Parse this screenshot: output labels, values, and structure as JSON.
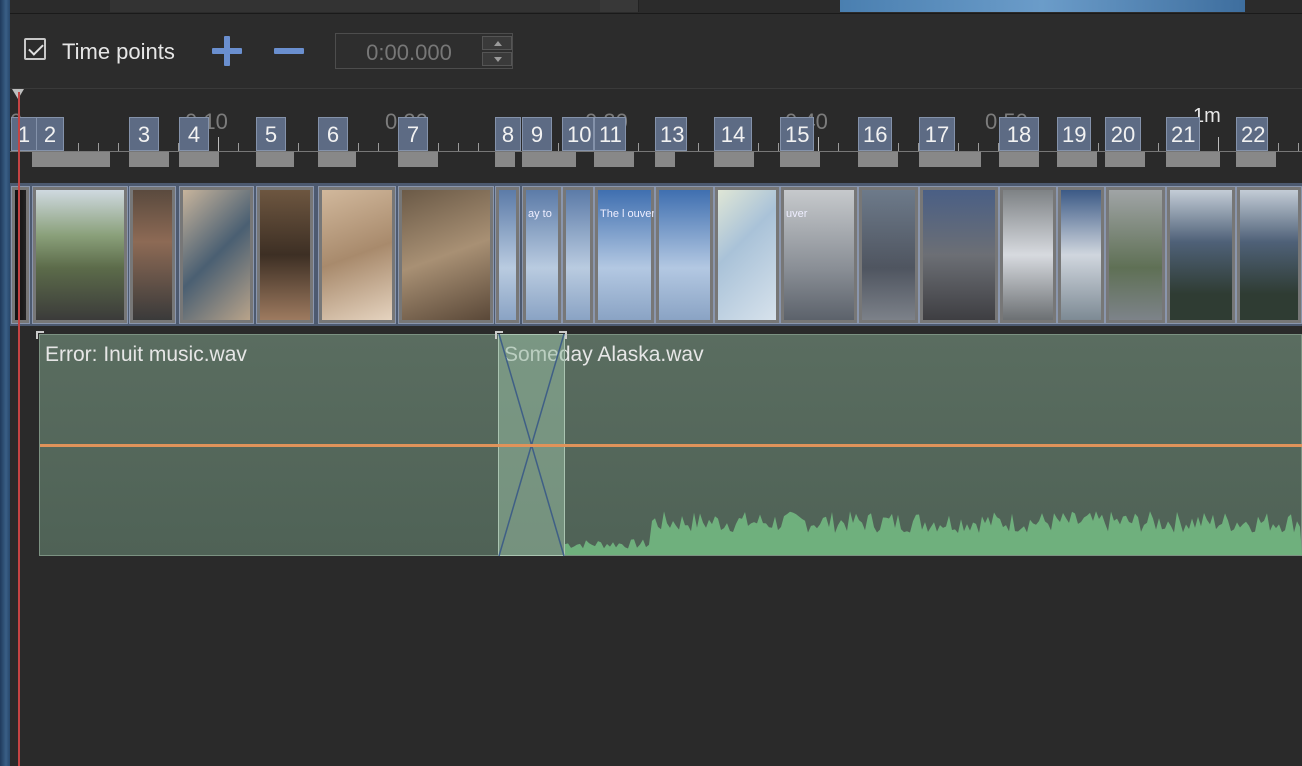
{
  "toolbar": {
    "time_points_label": "Time points",
    "time_points_checked": true,
    "time_value": "0:00.000"
  },
  "ruler": {
    "labels": [
      "0",
      "0:10",
      "0:20",
      "0:30",
      "0:40",
      "0:50",
      "1m"
    ]
  },
  "time_points": [
    "1",
    "2",
    "3",
    "4",
    "5",
    "6",
    "7",
    "8",
    "9",
    "10",
    "11",
    "13",
    "14",
    "15",
    "16",
    "17",
    "18",
    "19",
    "20",
    "21",
    "22"
  ],
  "slides": [
    {
      "caption": ""
    },
    {
      "caption": ""
    },
    {
      "caption": ""
    },
    {
      "caption": ""
    },
    {
      "caption": ""
    },
    {
      "caption": ""
    },
    {
      "caption": ""
    },
    {
      "caption": ""
    },
    {
      "caption": "ay to"
    },
    {
      "caption": ""
    },
    {
      "caption": "The l    ouver to Sk"
    },
    {
      "caption": ""
    },
    {
      "caption": ""
    },
    {
      "caption": "uver"
    },
    {
      "caption": ""
    },
    {
      "caption": ""
    },
    {
      "caption": ""
    },
    {
      "caption": ""
    },
    {
      "caption": ""
    },
    {
      "caption": ""
    },
    {
      "caption": ""
    }
  ],
  "audio": {
    "track1_title": "Error: Inuit music.wav",
    "track2_title": "Someday Alaska.wav"
  },
  "colors": {
    "accent": "#6a8fcf",
    "playhead": "#c44444",
    "volume_line": "#e0935a",
    "waveform": "#6fb07d"
  }
}
